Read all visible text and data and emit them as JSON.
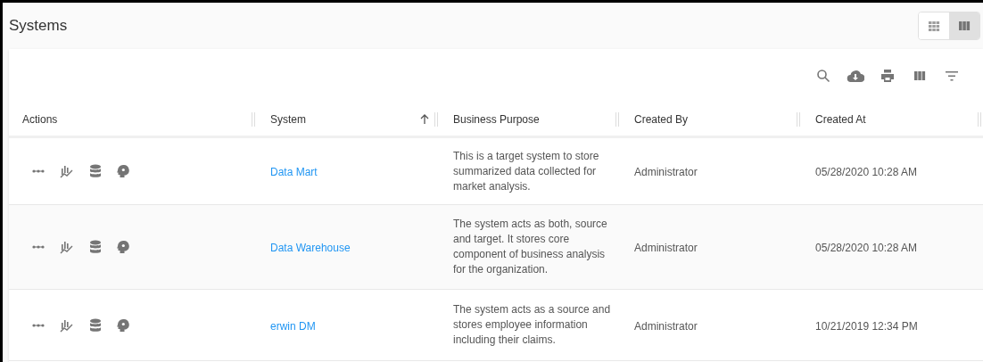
{
  "title": "Systems",
  "view_toggle": [
    {
      "kind": "grid",
      "selected": false
    },
    {
      "kind": "columns",
      "selected": true
    }
  ],
  "toolbar": [
    {
      "kind": "search"
    },
    {
      "kind": "download"
    },
    {
      "kind": "print"
    },
    {
      "kind": "columns"
    },
    {
      "kind": "filter"
    }
  ],
  "table": {
    "columns": [
      {
        "label": "Actions",
        "sorted": false
      },
      {
        "label": "System",
        "sorted": true
      },
      {
        "label": "Business Purpose",
        "sorted": false
      },
      {
        "label": "Created By",
        "sorted": false
      },
      {
        "label": "Created At",
        "sorted": false
      }
    ],
    "rows": [
      {
        "selected": false,
        "system": "Data Mart",
        "purpose": "This is a target system to store summarized data collected for market analysis.",
        "created_by": "Administrator",
        "created_at": "05/28/2020 10:28 AM"
      },
      {
        "selected": true,
        "system": "Data Warehouse",
        "purpose": "The system acts as both, source and target. It stores core component of business analysis for the organization.",
        "created_by": "Administrator",
        "created_at": "05/28/2020 10:28 AM"
      },
      {
        "selected": false,
        "system": "erwin DM",
        "purpose": "The system acts as a source and stores employee information including their claims.",
        "created_by": "Administrator",
        "created_at": "10/21/2019 12:34 PM"
      }
    ]
  }
}
